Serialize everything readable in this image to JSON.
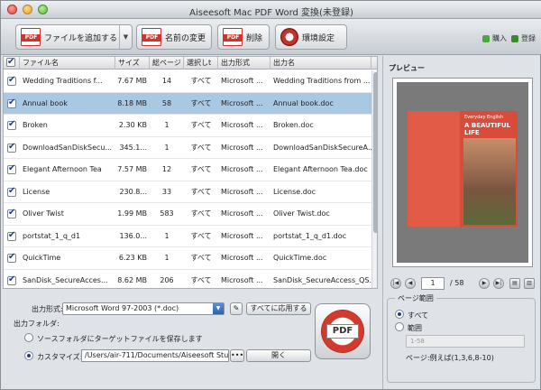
{
  "window": {
    "title": "Aiseesoft Mac PDF Word 変換(未登録)"
  },
  "toolbar": {
    "add_file": "ファイルを追加する",
    "rename": "名前の変更",
    "delete": "削除",
    "settings": "環境設定",
    "buy": "購入",
    "register": "登録",
    "pdf_icon_text": "PDF"
  },
  "table": {
    "headers": [
      "ファイル名",
      "サイズ",
      "総ページ",
      "選択しt",
      "出力形式",
      "出力名"
    ],
    "rows": [
      {
        "name": "Wedding Traditions f...",
        "size": "7.67 MB",
        "pages": "14",
        "selected": "すべて",
        "format": "Microsoft ...",
        "output": "Wedding Traditions from ..."
      },
      {
        "name": "Annual book",
        "size": "8.18 MB",
        "pages": "58",
        "selected": "すべて",
        "format": "Microsoft ...",
        "output": "Annual book.doc"
      },
      {
        "name": "Broken",
        "size": "2.30 KB",
        "pages": "1",
        "selected": "すべて",
        "format": "Microsoft ...",
        "output": "Broken.doc"
      },
      {
        "name": "DownloadSanDiskSecu...",
        "size": "345.1...",
        "pages": "1",
        "selected": "すべて",
        "format": "Microsoft ...",
        "output": "DownloadSanDiskSecureA..."
      },
      {
        "name": "Elegant Afternoon Tea",
        "size": "7.57 MB",
        "pages": "12",
        "selected": "すべて",
        "format": "Microsoft ...",
        "output": "Elegant Afternoon Tea.doc"
      },
      {
        "name": "License",
        "size": "230.8...",
        "pages": "33",
        "selected": "すべて",
        "format": "Microsoft ...",
        "output": "License.doc"
      },
      {
        "name": "Oliver Twist",
        "size": "1.99 MB",
        "pages": "583",
        "selected": "すべて",
        "format": "Microsoft ...",
        "output": "Oliver Twist.doc"
      },
      {
        "name": "portstat_1_q_d1",
        "size": "136.0...",
        "pages": "1",
        "selected": "すべて",
        "format": "Microsoft ...",
        "output": "portstat_1_q_d1.doc"
      },
      {
        "name": "QuickTime",
        "size": "6.23 KB",
        "pages": "1",
        "selected": "すべて",
        "format": "Microsoft ...",
        "output": "QuickTime.doc"
      },
      {
        "name": "SanDisk_SecureAcces...",
        "size": "8.62 MB",
        "pages": "206",
        "selected": "すべて",
        "format": "Microsoft ...",
        "output": "SanDisk_SecureAccess_QS..."
      }
    ],
    "selected_index": 1
  },
  "bottom": {
    "output_format_label": "出力形式:",
    "output_format_value": "Microsoft Word 97-2003 (*.doc)",
    "apply_all": "すべてに応用する",
    "output_folder_label": "出力フォルダ:",
    "source_folder_option": "ソースフォルダにターゲットファイルを保存します",
    "custom_option": "カスタマイズ:",
    "custom_path": "/Users/air-711/Documents/Aiseesoft Stu",
    "browse": "•••",
    "open": "開く",
    "convert_icon_text": "PDF"
  },
  "preview": {
    "title": "プレビュー",
    "page_current": "1",
    "page_total": "/ 58",
    "cover_line1": "Everyday English",
    "cover_line2": "A BEAUTIFUL LIFE",
    "range_title": "ページ範囲",
    "all_option": "すべて",
    "range_option": "範囲",
    "range_placeholder": "1-58",
    "range_hint": "ページ:例えば(1,3,6,8-10)"
  }
}
